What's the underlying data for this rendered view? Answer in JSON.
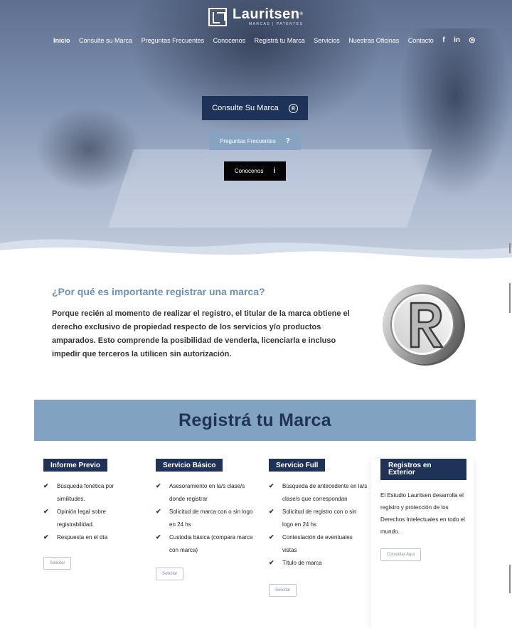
{
  "brand": {
    "name": "Lauritsen",
    "registered": "®",
    "tagline": "MARCAS | PATENTES"
  },
  "nav": {
    "items": [
      "Inicio",
      "Consulte su Marca",
      "Preguntas Frecuentes",
      "Conocenos",
      "Registrá tu Marca",
      "Servicios",
      "Nuestras Oficinas",
      "Contacto"
    ],
    "social": [
      "f",
      "in",
      "◎"
    ],
    "social_icons": [
      "facebook-icon",
      "linkedin-icon",
      "instagram-icon"
    ]
  },
  "hero": {
    "consulte_label": "Consulte Su Marca",
    "consulte_icon": "®",
    "preguntas_label": "Preguntas Frecuentes",
    "preguntas_icon": "?",
    "conocenos_label": "Conocenos",
    "conocenos_icon": "i"
  },
  "intro": {
    "title": "¿Por qué es importante registrar una marca?",
    "text": "Porque recién al momento de realizar el registro, el titular de la marca obtiene el derecho exclusivo de propiedad respecto de los servicios y/o productos amparados. Esto comprende la posibilidad de venderla, licenciarla e incluso impedir que terceros la utilicen sin autorización."
  },
  "banner": {
    "title": "Registrá tu Marca"
  },
  "services": [
    {
      "title": "Informe Previo",
      "items": [
        "Búsqueda fonética por similitudes.",
        "Opinión legal sobre registrabilidad.",
        "Respuesta en el día"
      ],
      "button": "Solicitar"
    },
    {
      "title": "Servicio Básico",
      "items": [
        "Asesoramiento en la/s clase/s donde registrar",
        "Solicitud de marca con o sin logo en 24 hs",
        "Custodia básica (compara marca con marca)"
      ],
      "button": "Solicitar"
    },
    {
      "title": "Servicio Full",
      "items": [
        "Búsqueda de antecedente en la/s clase/s que correspondan",
        "Solicitud de registro con o sin logo en 24 hs",
        "Contestación de eventuales vistas",
        "Título de marca"
      ],
      "button": "Solicitar"
    },
    {
      "title": "Registros en Exterior",
      "text": "El Estudio Lauritsen desarrolla el registro y protección de los Derechos Intelectuales en todo el mundo.",
      "button": "Consultar Aquí"
    }
  ],
  "colors": {
    "navy": "#1f3358",
    "steel_blue": "#82a2c1",
    "light_blue_text": "#6f8fb3",
    "black_button": "#050505"
  }
}
